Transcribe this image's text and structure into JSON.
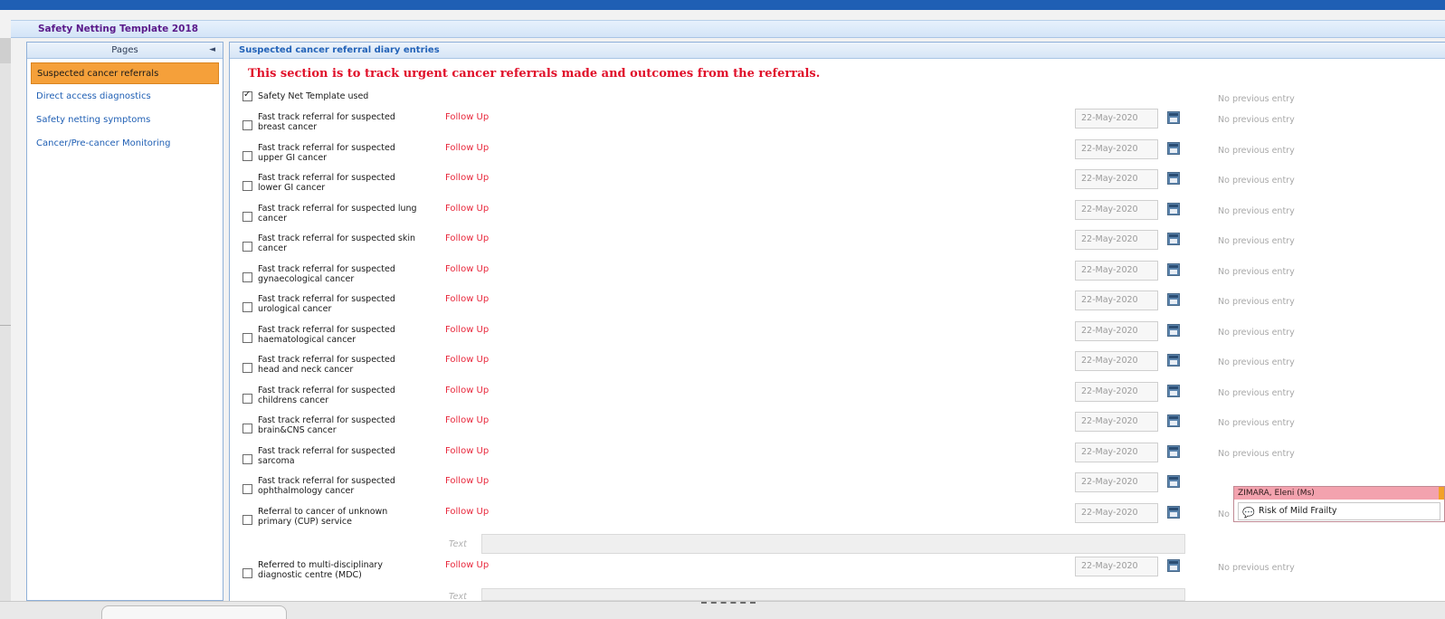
{
  "window": {
    "title": "Safety Netting Template 2018"
  },
  "sidebar": {
    "header": "Pages",
    "collapse_icon": "triangle-left-icon",
    "items": [
      {
        "label": "Suspected cancer referrals",
        "active": true
      },
      {
        "label": "Direct access diagnostics",
        "active": false
      },
      {
        "label": "Safety netting symptoms",
        "active": false
      },
      {
        "label": "Cancer/Pre-cancer Monitoring",
        "active": false
      }
    ]
  },
  "content": {
    "header": "Suspected cancer referral diary entries",
    "banner": "This section is to track urgent cancer referrals made and outcomes from the referrals.",
    "template_used": {
      "label": "Safety Net Template used",
      "checked": true,
      "status": "No previous entry"
    },
    "follow_up_label": "Follow Up",
    "date_value": "22-May-2020",
    "no_previous_entry": "No previous entry",
    "text_label": "Text",
    "rows": [
      {
        "line1": "Fast track referral for suspected",
        "line2": "breast cancer"
      },
      {
        "line1": "Fast track referral for suspected",
        "line2": "upper GI cancer"
      },
      {
        "line1": "Fast track referral for suspected",
        "line2": "lower GI cancer"
      },
      {
        "line1": "Fast track referral for suspected lung",
        "line2": "cancer"
      },
      {
        "line1": "Fast track referral for suspected skin",
        "line2": "cancer"
      },
      {
        "line1": "Fast track referral for suspected",
        "line2": "gynaecological cancer"
      },
      {
        "line1": "Fast track referral for suspected",
        "line2": "urological cancer"
      },
      {
        "line1": "Fast track referral for suspected",
        "line2": "haematological cancer"
      },
      {
        "line1": "Fast track referral for suspected",
        "line2": "head and neck cancer"
      },
      {
        "line1": "Fast track referral for suspected",
        "line2": "childrens cancer"
      },
      {
        "line1": "Fast track referral for suspected",
        "line2": "brain&CNS cancer"
      },
      {
        "line1": "Fast track referral for suspected",
        "line2": "sarcoma"
      },
      {
        "line1": "Fast track referral for suspected",
        "line2": "ophthalmology cancer"
      },
      {
        "line1": "Referral to cancer of unknown",
        "line2": "primary (CUP) service"
      }
    ],
    "mdc_row": {
      "line1": "Referred to multi-disciplinary",
      "line2": "diagnostic centre (MDC)"
    }
  },
  "popup": {
    "patient": "ZIMARA, Eleni (Ms)",
    "alert": "Risk of Mild Frailty",
    "status_prefix": "No",
    "icon": "speech-bubble-icon"
  },
  "colors": {
    "accent": "#1f5fb4",
    "active_item": "#f5a03a",
    "banner_red": "#e0102a",
    "follow_up": "#e8283c",
    "popup_header": "#f3a2ae"
  }
}
